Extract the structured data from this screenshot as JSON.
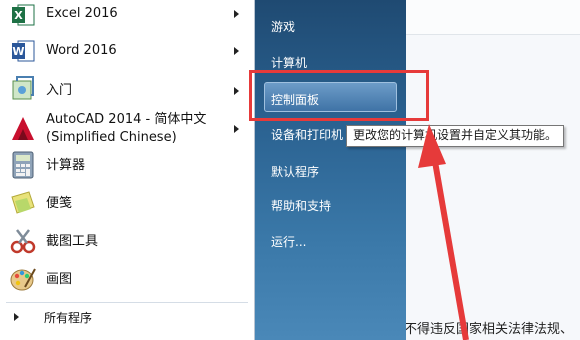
{
  "left_menu": {
    "items": [
      {
        "label": "Excel 2016"
      },
      {
        "label": "Word 2016"
      },
      {
        "label": "入门"
      },
      {
        "label": "AutoCAD 2014 - 简体中文",
        "label2": "(Simplified Chinese)"
      },
      {
        "label": "计算器"
      },
      {
        "label": "便笺"
      },
      {
        "label": "截图工具"
      },
      {
        "label": "画图"
      }
    ],
    "all_programs": "所有程序"
  },
  "right_menu": {
    "items": [
      "游戏",
      "计算机",
      "控制面板",
      "设备和打印机",
      "默认程序",
      "帮助和支持",
      "运行..."
    ]
  },
  "tooltip": "更改您的计算机设置并自定义其功能。",
  "background_text": "不得违反国家相关法律法规、",
  "colors": {
    "highlight": "#e63a3a",
    "panel": "#2a6190"
  }
}
